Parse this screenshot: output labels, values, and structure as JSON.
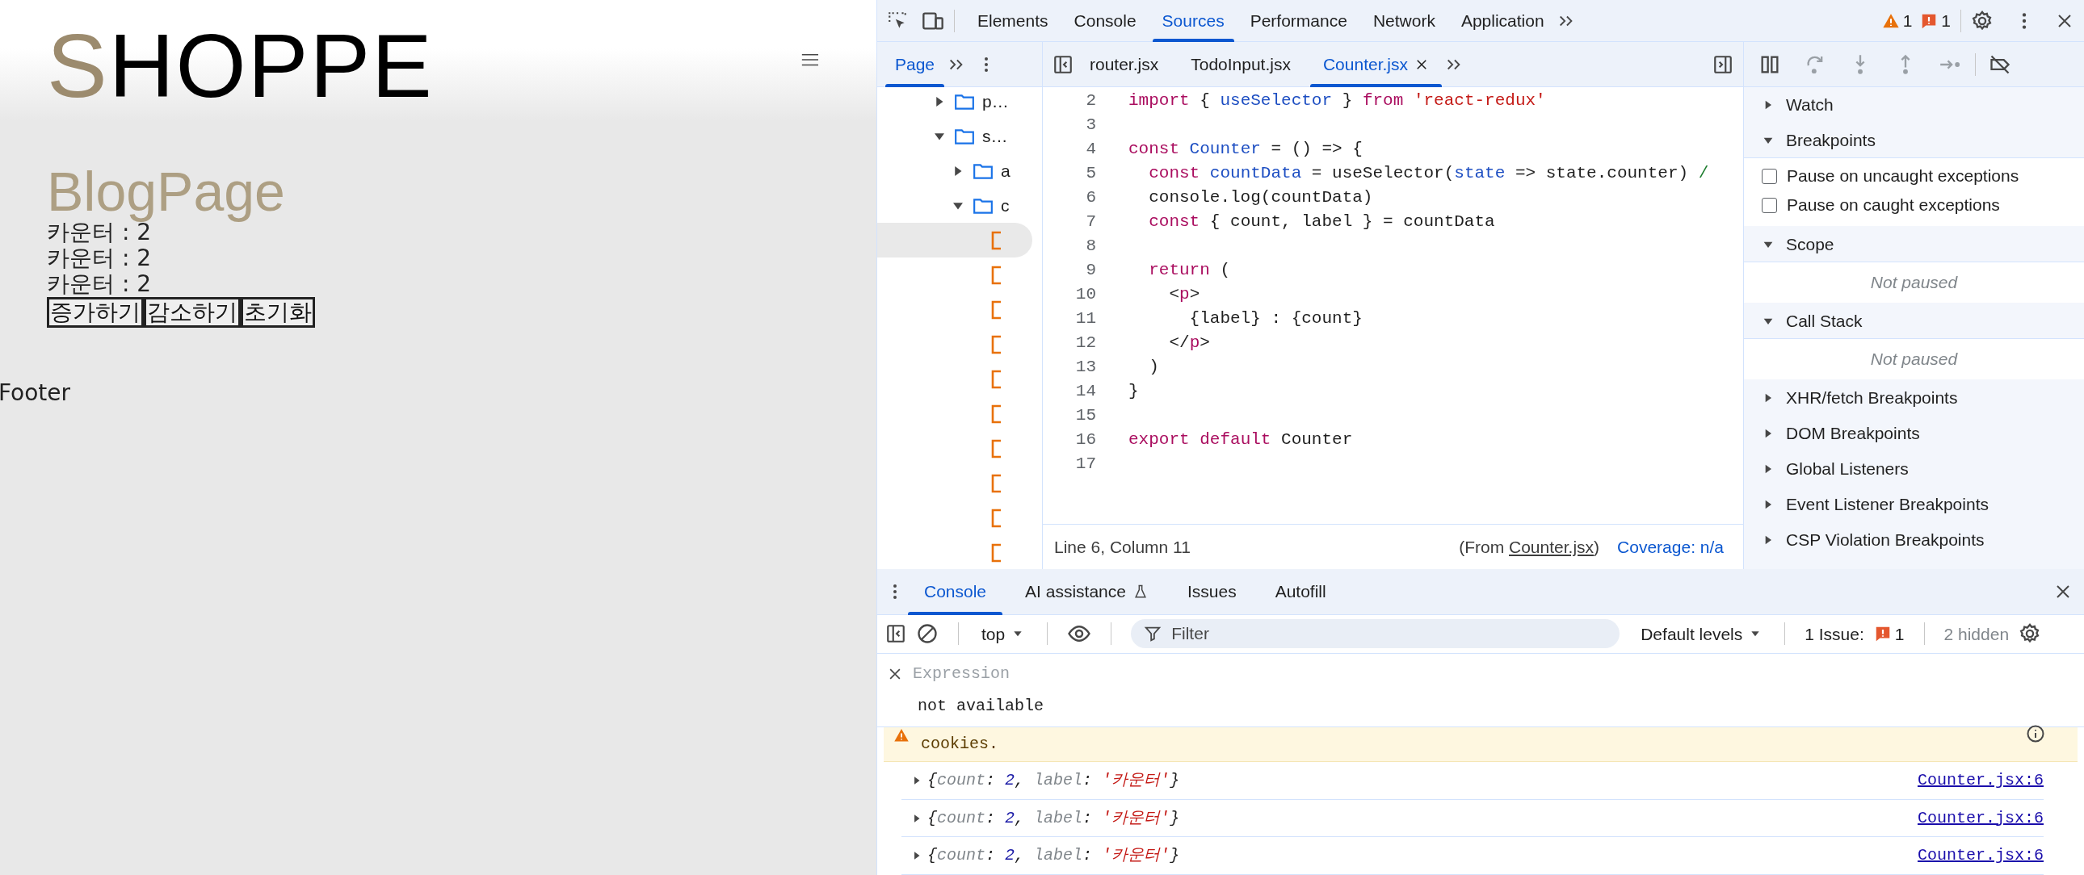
{
  "page": {
    "logo": "SHOPPE",
    "heading": "BlogPage",
    "counters": [
      "카운터 : 2",
      "카운터 : 2",
      "카운터 : 2"
    ],
    "buttons": [
      "증가하기",
      "감소하기",
      "초기화"
    ],
    "footer": "Footer"
  },
  "devtools": {
    "tabs": [
      {
        "label": "Elements",
        "selected": false
      },
      {
        "label": "Console",
        "selected": false
      },
      {
        "label": "Sources",
        "selected": true
      },
      {
        "label": "Performance",
        "selected": false
      },
      {
        "label": "Network",
        "selected": false
      },
      {
        "label": "Application",
        "selected": false
      }
    ],
    "warnings": "1",
    "errors": "1",
    "navigator": {
      "tabs": [
        {
          "label": "Page",
          "selected": true
        }
      ],
      "tree": [
        {
          "kind": "folder",
          "name": "p…",
          "expanded": false
        },
        {
          "kind": "folder",
          "name": "s…",
          "expanded": true,
          "children": [
            {
              "kind": "folder",
              "name": "a",
              "expanded": false
            },
            {
              "kind": "folder",
              "name": "c",
              "expanded": true,
              "children": [
                {
                  "kind": "file",
                  "selected": true
                },
                {
                  "kind": "file",
                  "selected": false
                },
                {
                  "kind": "file",
                  "selected": false
                },
                {
                  "kind": "file",
                  "selected": false
                },
                {
                  "kind": "file",
                  "selected": false
                },
                {
                  "kind": "file",
                  "selected": false
                },
                {
                  "kind": "file",
                  "selected": false
                },
                {
                  "kind": "file",
                  "selected": false
                },
                {
                  "kind": "file",
                  "selected": false
                },
                {
                  "kind": "file",
                  "selected": false
                }
              ]
            }
          ]
        }
      ]
    },
    "editor": {
      "tabs": [
        {
          "label": "router.jsx",
          "selected": false,
          "closable": false
        },
        {
          "label": "TodoInput.jsx",
          "selected": false,
          "closable": false
        },
        {
          "label": "Counter.jsx",
          "selected": true,
          "closable": true
        }
      ],
      "lines": [
        {
          "number": "2",
          "tokens": [
            {
              "kind": "kw",
              "text": "import"
            },
            {
              "kind": "plain",
              "text": " { "
            },
            {
              "kind": "def",
              "text": "useSelector"
            },
            {
              "kind": "plain",
              "text": " } "
            },
            {
              "kind": "kw",
              "text": "from"
            },
            {
              "kind": "str",
              "text": " 'react-redux'"
            }
          ]
        },
        {
          "number": "3"
        },
        {
          "number": "4",
          "tokens": [
            {
              "kind": "kw",
              "text": "const"
            },
            {
              "kind": "def",
              "text": " Counter"
            },
            {
              "kind": "plain",
              "text": " = () => {"
            }
          ]
        },
        {
          "number": "5",
          "tokens": [
            {
              "kind": "kw",
              "text": "  const"
            },
            {
              "kind": "def",
              "text": " countData"
            },
            {
              "kind": "plain",
              "text": " = useSelector("
            },
            {
              "kind": "def",
              "text": "state"
            },
            {
              "kind": "plain",
              "text": " => state.counter) "
            },
            {
              "kind": "comment",
              "text": "/"
            }
          ]
        },
        {
          "number": "6",
          "tokens": [
            {
              "kind": "plain",
              "text": "  console.log(countData)"
            }
          ]
        },
        {
          "number": "7",
          "tokens": [
            {
              "kind": "kw",
              "text": "  const"
            },
            {
              "kind": "plain",
              "text": " { count, label } = countData"
            }
          ]
        },
        {
          "number": "8"
        },
        {
          "number": "9",
          "tokens": [
            {
              "kind": "kw",
              "text": "  return"
            },
            {
              "kind": "plain",
              "text": " ("
            }
          ]
        },
        {
          "number": "10",
          "tokens": [
            {
              "kind": "plain",
              "text": "    <"
            },
            {
              "kind": "kw",
              "text": "p"
            },
            {
              "kind": "plain",
              "text": ">"
            }
          ]
        },
        {
          "number": "11",
          "tokens": [
            {
              "kind": "plain",
              "text": "      {label} : {count}"
            }
          ]
        },
        {
          "number": "12",
          "tokens": [
            {
              "kind": "plain",
              "text": "    </"
            },
            {
              "kind": "kw",
              "text": "p"
            },
            {
              "kind": "plain",
              "text": ">"
            }
          ]
        },
        {
          "number": "13",
          "tokens": [
            {
              "kind": "plain",
              "text": "  )"
            }
          ]
        },
        {
          "number": "14",
          "tokens": [
            {
              "kind": "plain",
              "text": "}"
            }
          ]
        },
        {
          "number": "15"
        },
        {
          "number": "16",
          "tokens": [
            {
              "kind": "kw",
              "text": "export"
            },
            {
              "kind": "kw",
              "text": " default"
            },
            {
              "kind": "plain",
              "text": " Counter"
            }
          ]
        },
        {
          "number": "17"
        }
      ],
      "status": {
        "position": "Line 6, Column 11",
        "from_prefix": "(From ",
        "from_link": "Counter.jsx",
        "from_suffix": ")",
        "coverage": "Coverage: n/a"
      }
    },
    "debugger": {
      "controls": [
        {
          "kind": "pause",
          "disabled": false
        },
        {
          "kind": "step-over",
          "disabled": true
        },
        {
          "kind": "step-into",
          "disabled": true
        },
        {
          "kind": "step-out",
          "disabled": true
        },
        {
          "kind": "step",
          "disabled": true
        },
        {
          "kind": "deactivate",
          "disabled": false
        }
      ],
      "sections": [
        {
          "title": "Watch",
          "expanded": false
        },
        {
          "title": "Breakpoints",
          "expanded": true,
          "options": [
            {
              "label": "Pause on uncaught exceptions",
              "checked": false
            },
            {
              "label": "Pause on caught exceptions",
              "checked": false
            }
          ]
        },
        {
          "title": "Scope",
          "expanded": true,
          "message": "Not paused"
        },
        {
          "title": "Call Stack",
          "expanded": true,
          "message": "Not paused"
        },
        {
          "title": "XHR/fetch Breakpoints",
          "expanded": false
        },
        {
          "title": "DOM Breakpoints",
          "expanded": false
        },
        {
          "title": "Global Listeners",
          "expanded": false
        },
        {
          "title": "Event Listener Breakpoints",
          "expanded": false
        },
        {
          "title": "CSP Violation Breakpoints",
          "expanded": false
        }
      ]
    },
    "drawer": {
      "tabs": [
        {
          "label": "Console",
          "selected": true,
          "kind": "plain"
        },
        {
          "label": "AI assistance",
          "selected": false,
          "kind": "experimental"
        },
        {
          "label": "Issues",
          "selected": false,
          "kind": "plain"
        },
        {
          "label": "Autofill",
          "selected": false,
          "kind": "plain"
        }
      ],
      "context": "top",
      "filter_placeholder": "Filter",
      "levels": "Default levels",
      "issues_label": "1 Issue:",
      "issues_count": "1",
      "hidden": "2 hidden",
      "expression": {
        "placeholder": "Expression",
        "result": "not available"
      },
      "messages": [
        {
          "kind": "warning",
          "text": "cookies."
        },
        {
          "kind": "log",
          "expanded": false,
          "tokens": [
            {
              "kind": "punct",
              "text": "{"
            },
            {
              "kind": "key",
              "text": "count"
            },
            {
              "kind": "punct",
              "text": ": "
            },
            {
              "kind": "num",
              "text": "2"
            },
            {
              "kind": "punct",
              "text": ", "
            },
            {
              "kind": "key",
              "text": "label"
            },
            {
              "kind": "punct",
              "text": ": "
            },
            {
              "kind": "str",
              "text": "'카운터'"
            },
            {
              "kind": "punct",
              "text": "}"
            }
          ],
          "source": "Counter.jsx:6"
        },
        {
          "kind": "log",
          "expanded": false,
          "tokens": [
            {
              "kind": "punct",
              "text": "{"
            },
            {
              "kind": "key",
              "text": "count"
            },
            {
              "kind": "punct",
              "text": ": "
            },
            {
              "kind": "num",
              "text": "2"
            },
            {
              "kind": "punct",
              "text": ", "
            },
            {
              "kind": "key",
              "text": "label"
            },
            {
              "kind": "punct",
              "text": ": "
            },
            {
              "kind": "str",
              "text": "'카운터'"
            },
            {
              "kind": "punct",
              "text": "}"
            }
          ],
          "source": "Counter.jsx:6"
        },
        {
          "kind": "log",
          "expanded": false,
          "tokens": [
            {
              "kind": "punct",
              "text": "{"
            },
            {
              "kind": "key",
              "text": "count"
            },
            {
              "kind": "punct",
              "text": ": "
            },
            {
              "kind": "num",
              "text": "2"
            },
            {
              "kind": "punct",
              "text": ", "
            },
            {
              "kind": "key",
              "text": "label"
            },
            {
              "kind": "punct",
              "text": ": "
            },
            {
              "kind": "str",
              "text": "'카운터'"
            },
            {
              "kind": "punct",
              "text": "}"
            }
          ],
          "source": "Counter.jsx:6"
        }
      ]
    }
  }
}
